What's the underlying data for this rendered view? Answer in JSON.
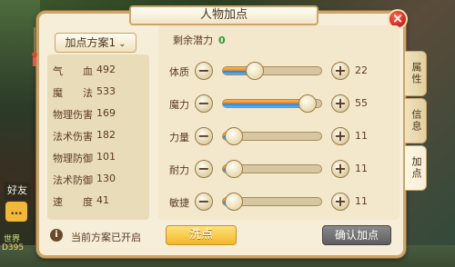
{
  "game": {
    "sidebar": {
      "friends_label": "好友",
      "world_label": "世界",
      "code_label": "D395"
    }
  },
  "panel": {
    "title": "人物加点",
    "close_symbol": "×"
  },
  "scheme": {
    "label": "加点方案1",
    "chevron": "⌄"
  },
  "stats": [
    {
      "key": "气　　血",
      "value": "492"
    },
    {
      "key": "魔　　法",
      "value": "533"
    },
    {
      "key": "物理伤害",
      "value": "169"
    },
    {
      "key": "法术伤害",
      "value": "182"
    },
    {
      "key": "物理防御",
      "value": "101"
    },
    {
      "key": "法术防御",
      "value": "130"
    },
    {
      "key": "速　　度",
      "value": "41"
    }
  ],
  "info": {
    "icon": "i",
    "text": "当前方案已开启"
  },
  "remaining": {
    "label": "剩余潜力",
    "value": "0"
  },
  "attributes": [
    {
      "name": "体质",
      "value": "22",
      "level": 0.33
    },
    {
      "name": "魔力",
      "value": "55",
      "level": 0.85
    },
    {
      "name": "力量",
      "value": "11",
      "level": 0.12
    },
    {
      "name": "耐力",
      "value": "11",
      "level": 0.12
    },
    {
      "name": "敏捷",
      "value": "11",
      "level": 0.12
    }
  ],
  "controls": {
    "minus_symbol": "−",
    "plus_symbol": "+"
  },
  "buttons": {
    "wash": "洗点",
    "confirm": "确认加点"
  },
  "tabs": [
    {
      "label": "属性",
      "active": false
    },
    {
      "label": "信息",
      "active": false
    },
    {
      "label": "加点",
      "active": true
    }
  ]
}
